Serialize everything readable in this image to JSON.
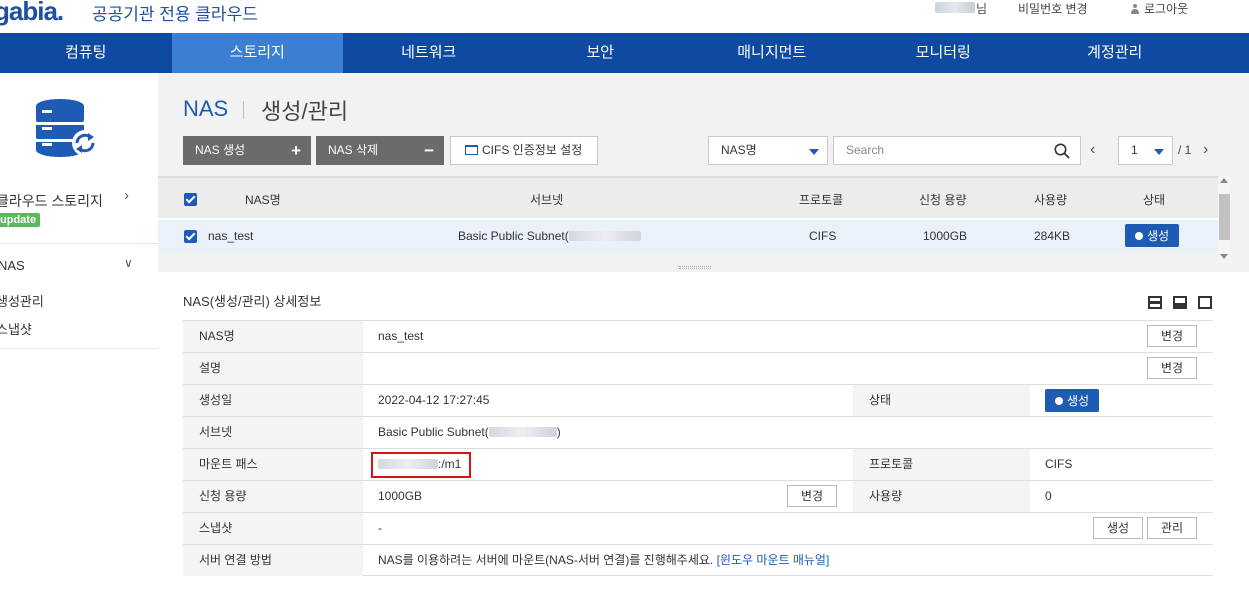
{
  "header": {
    "logo": "gabia.",
    "subtitle": "공공기관 전용 클라우드",
    "user_suffix": "님",
    "change_password": "비밀번호 변경",
    "logout": "로그아웃"
  },
  "nav": {
    "items": [
      {
        "label": "컴퓨팅"
      },
      {
        "label": "스토리지"
      },
      {
        "label": "네트워크"
      },
      {
        "label": "보안"
      },
      {
        "label": "매니지먼트"
      },
      {
        "label": "모니터링"
      },
      {
        "label": "계정관리"
      }
    ],
    "active_index": 1
  },
  "sidebar": {
    "section": "클라우드 스토리지",
    "badge": "update",
    "group": "NAS",
    "sub_items": [
      {
        "label": "생성관리"
      },
      {
        "label": "스냅샷"
      }
    ]
  },
  "page": {
    "title": "NAS",
    "subtitle": "생성/관리"
  },
  "toolbar": {
    "create_label": "NAS 생성",
    "create_symbol": "+",
    "delete_label": "NAS 삭제",
    "delete_symbol": "−",
    "cifs_label": "CIFS 인증정보 설정",
    "filter_selected": "NAS명",
    "search_placeholder": "Search",
    "page_current": "1",
    "page_total": "/ 1"
  },
  "list": {
    "columns": [
      "NAS명",
      "서브넷",
      "프로토콜",
      "신청 용량",
      "사용량",
      "상태"
    ],
    "rows": [
      {
        "name": "nas_test",
        "subnet": "Basic Public Subnet(",
        "protocol": "CIFS",
        "capacity": "1000GB",
        "usage": "284KB",
        "status": "생성"
      }
    ]
  },
  "detail": {
    "title": "NAS(생성/관리) 상세정보",
    "change_label": "변경",
    "create_label": "생성",
    "manage_label": "관리",
    "rows": {
      "name_label": "NAS명",
      "name_value": "nas_test",
      "desc_label": "설명",
      "desc_value": "",
      "created_label": "생성일",
      "created_value": "2022-04-12 17:27:45",
      "status_label": "상태",
      "status_value": "생성",
      "subnet_label": "서브넷",
      "subnet_value": "Basic Public Subnet(",
      "subnet_close": ")",
      "mount_label": "마운트 패스",
      "mount_value": ":/m1",
      "protocol_label": "프로토콜",
      "protocol_value": "CIFS",
      "capacity_label": "신청 용량",
      "capacity_value": "1000GB",
      "usage_label": "사용량",
      "usage_value": "0",
      "snapshot_label": "스냅샷",
      "snapshot_value": "-",
      "connect_label": "서버 연결 방법",
      "connect_text": "NAS를 이용하려는 서버에 마운트(NAS-서버 연결)를 진행해주세요.",
      "connect_link": "[윈도우 마운트 매뉴얼]"
    }
  },
  "colors": {
    "nav_bg": "#0e4aa1",
    "nav_active": "#3b7fd4",
    "accent": "#1e5bb5",
    "badge_green": "#5cb85c",
    "highlight_red": "#dd1111"
  }
}
